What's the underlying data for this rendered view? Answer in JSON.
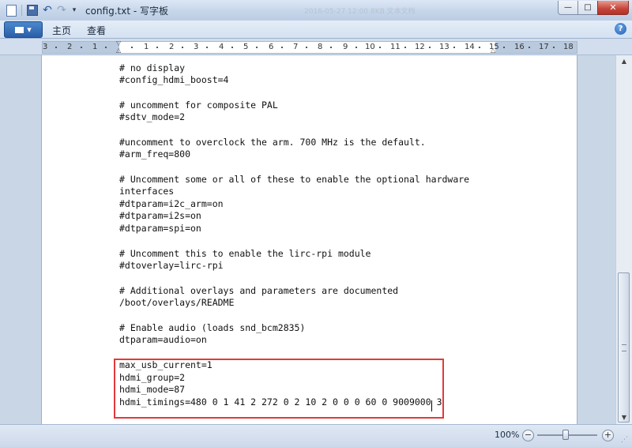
{
  "window": {
    "title": "config.txt - 写字板",
    "faded_title_text": "2016-05-27 12:00          8KB          文本文档"
  },
  "quick_access": {
    "undo_glyph": "↶",
    "redo_glyph": "↷",
    "more_glyph": "▾"
  },
  "window_controls": {
    "minimize": "—",
    "maximize": "□",
    "close": "✕"
  },
  "ribbon": {
    "app_menu_glyph": "▾",
    "tabs": [
      "主页",
      "查看"
    ],
    "help": "?"
  },
  "ruler": {
    "labels": [
      "3",
      "2",
      "1",
      "1",
      "2",
      "3",
      "4",
      "5",
      "6",
      "7",
      "8",
      "9",
      "10",
      "11",
      "12",
      "13",
      "14",
      "15",
      "16",
      "17",
      "18"
    ]
  },
  "document": {
    "lines": [
      "# no display",
      "#config_hdmi_boost=4",
      "",
      "# uncomment for composite PAL",
      "#sdtv_mode=2",
      "",
      "#uncomment to overclock the arm. 700 MHz is the default.",
      "#arm_freq=800",
      "",
      "# Uncomment some or all of these to enable the optional hardware",
      "interfaces",
      "#dtparam=i2c_arm=on",
      "#dtparam=i2s=on",
      "#dtparam=spi=on",
      "",
      "# Uncomment this to enable the lirc-rpi module",
      "#dtoverlay=lirc-rpi",
      "",
      "# Additional overlays and parameters are documented",
      "/boot/overlays/README",
      "",
      "# Enable audio (loads snd_bcm2835)",
      "dtparam=audio=on",
      "",
      "max_usb_current=1",
      "hdmi_group=2",
      "hdmi_mode=87",
      "hdmi_timings=480 0 1 41 2 272 0 2 10 2 0 0 0 60 0 9009000 3"
    ],
    "highlight_color": "#e33a3a"
  },
  "scrollbar": {
    "up_glyph": "▲",
    "down_glyph": "▼"
  },
  "status": {
    "zoom_level": "100%",
    "zoom_out": "−",
    "zoom_in": "+"
  }
}
